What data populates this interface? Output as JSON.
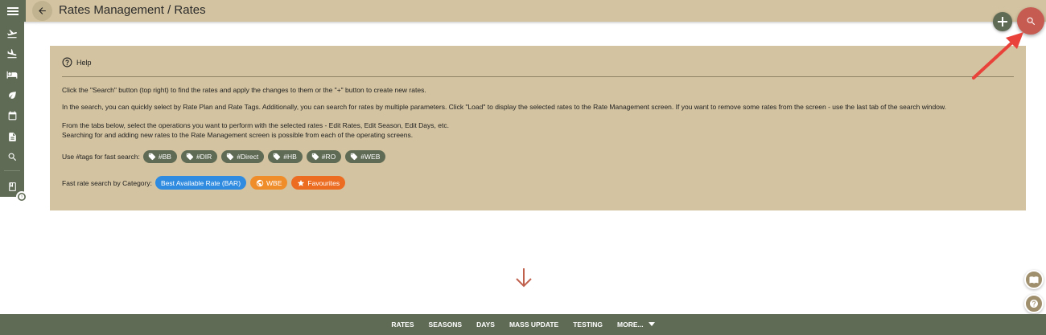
{
  "header": {
    "title": "Rates Management / Rates"
  },
  "sidebar": {
    "items": [
      {
        "icon": "flight-takeoff-icon"
      },
      {
        "icon": "flight-landing-icon"
      },
      {
        "icon": "hotel-bed-icon"
      },
      {
        "icon": "leaf-icon"
      },
      {
        "icon": "calendar-icon"
      },
      {
        "icon": "document-icon"
      },
      {
        "icon": "search-icon"
      },
      {
        "icon": "book-icon"
      }
    ]
  },
  "help": {
    "title": "Help",
    "paragraph1": "Click the \"Search\" button (top right) to find the rates and apply the changes to them or the \"+\" button to create new rates.",
    "paragraph2": "In the search, you can quickly select by Rate Plan and Rate Tags. Additionally, you can search for rates by multiple parameters. Click \"Load\" to display the selected rates to the Rate Management screen. If you want to remove some rates from the screen - use the last tab of the search window.",
    "paragraph3_line1": "From the tabs below, select the operations you want to perform with the selected rates - Edit Rates, Edit Season, Edit Days, etc.",
    "paragraph3_line2": "Searching for and adding new rates to the Rate Management screen is possible from each of the operating screens.",
    "tags_label": "Use #tags for fast search:",
    "tags": [
      "#BB",
      "#DIR",
      "#Direct",
      "#HB",
      "#RO",
      "#WEB"
    ],
    "category_label": "Fast rate search by Category:",
    "categories": [
      {
        "label": "Best Available Rate (BAR)",
        "color": "#2f8be0"
      },
      {
        "label": "WBE",
        "color": "#f08d2b"
      },
      {
        "label": "Favourites",
        "color": "#ec6c22"
      }
    ]
  },
  "bottom_nav": {
    "tabs": [
      "RATES",
      "SEASONS",
      "DAYS",
      "MASS UPDATE",
      "TESTING"
    ],
    "more_label": "MORE..."
  },
  "colors": {
    "accent_bar": "#d3c3a0",
    "dark_green": "#5f6b55",
    "search_fab": "#c65b52",
    "annotation_arrow": "#e8423a"
  }
}
